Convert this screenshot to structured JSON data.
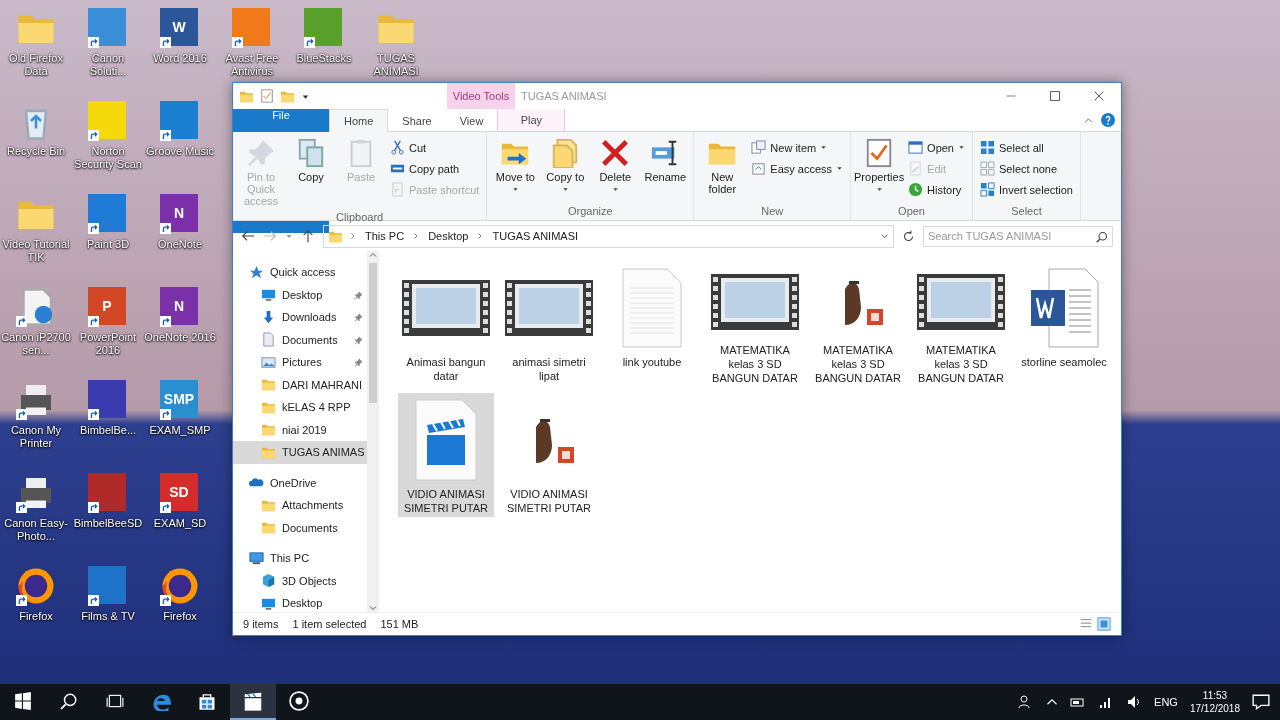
{
  "desktop_columns": [
    [
      {
        "label": "Old Firefox Data",
        "kind": "folder"
      },
      {
        "label": "Recycle Bin",
        "kind": "recycle"
      },
      {
        "label": "Video Tutorial TIK",
        "kind": "folder"
      },
      {
        "label": "Canon iP2700 sen...",
        "kind": "document"
      },
      {
        "label": "Canon My Printer",
        "kind": "printer"
      },
      {
        "label": "Canon Easy-Photo...",
        "kind": "printer"
      },
      {
        "label": "Firefox",
        "kind": "firefox"
      }
    ],
    [
      {
        "label": "Canon Soluti...",
        "kind": "app",
        "color": "#3a8fd8"
      },
      {
        "label": "Norton Security Scan",
        "kind": "app",
        "color": "#f5d90a"
      },
      {
        "label": "Paint 3D",
        "kind": "app",
        "color": "#1f7ad6"
      },
      {
        "label": "PowerPoint 2016",
        "kind": "app",
        "color": "#d24726",
        "icon_text": "P"
      },
      {
        "label": "BimbelBe...",
        "kind": "app",
        "color": "#3b3bb0"
      },
      {
        "label": "BimbelBeeSD",
        "kind": "app",
        "color": "#b02a2a"
      },
      {
        "label": "Films & TV",
        "kind": "app",
        "color": "#1e73c8"
      }
    ],
    [
      {
        "label": "Word 2016",
        "kind": "app",
        "color": "#2b579a",
        "icon_text": "W"
      },
      {
        "label": "Groove Music",
        "kind": "app",
        "color": "#1a7fd0"
      },
      {
        "label": "OneNote",
        "kind": "app",
        "color": "#7b2fa8",
        "icon_text": "N"
      },
      {
        "label": "OneNote 2016",
        "kind": "app",
        "color": "#7b2fa8",
        "icon_text": "N"
      },
      {
        "label": "EXAM_SMP",
        "kind": "app",
        "color": "#2a8fd0",
        "icon_text": "SMP"
      },
      {
        "label": "EXAM_SD",
        "kind": "app",
        "color": "#d62b2b",
        "icon_text": "SD"
      },
      {
        "label": "Firefox",
        "kind": "firefox"
      }
    ],
    [
      {
        "label": "Avast Free Antivirus",
        "kind": "app",
        "color": "#f07a1a"
      }
    ],
    [
      {
        "label": "BlueStacks",
        "kind": "app",
        "color": "#5aa02c"
      }
    ],
    [
      {
        "label": "TUGAS ANIMASI",
        "kind": "folder"
      }
    ]
  ],
  "window": {
    "title": "TUGAS ANIMASI",
    "context_tab_header": "Video Tools",
    "tabs": [
      {
        "label": "File",
        "kind": "file",
        "selected": false
      },
      {
        "label": "Home",
        "kind": "tab",
        "selected": true
      },
      {
        "label": "Share",
        "kind": "tab",
        "selected": false
      },
      {
        "label": "View",
        "kind": "tab",
        "selected": false
      },
      {
        "label": "Play",
        "kind": "context",
        "selected": false
      }
    ],
    "ribbon_groups": [
      {
        "label": "Clipboard",
        "commands": [
          {
            "label": "Pin to Quick access",
            "kind": "large",
            "disabled": true,
            "dropdown": false
          },
          {
            "label": "Copy",
            "kind": "large",
            "disabled": false,
            "dropdown": false
          },
          {
            "label": "Paste",
            "kind": "large",
            "disabled": true,
            "dropdown": false
          },
          {
            "label": "Cut",
            "kind": "small",
            "disabled": false,
            "dropdown": false
          },
          {
            "label": "Copy path",
            "kind": "small",
            "disabled": false,
            "dropdown": false
          },
          {
            "label": "Paste shortcut",
            "kind": "small",
            "disabled": true,
            "dropdown": false
          }
        ]
      },
      {
        "label": "Organize",
        "commands": [
          {
            "label": "Move to",
            "kind": "large",
            "disabled": false,
            "dropdown": true
          },
          {
            "label": "Copy to",
            "kind": "large",
            "disabled": false,
            "dropdown": true
          },
          {
            "label": "Delete",
            "kind": "large",
            "disabled": false,
            "dropdown": true
          },
          {
            "label": "Rename",
            "kind": "large",
            "disabled": false,
            "dropdown": false
          }
        ]
      },
      {
        "label": "New",
        "commands": [
          {
            "label": "New folder",
            "kind": "large",
            "disabled": false,
            "dropdown": false
          },
          {
            "label": "New item",
            "kind": "small",
            "disabled": false,
            "dropdown": true
          },
          {
            "label": "Easy access",
            "kind": "small",
            "disabled": false,
            "dropdown": true
          }
        ]
      },
      {
        "label": "Open",
        "commands": [
          {
            "label": "Properties",
            "kind": "large",
            "disabled": false,
            "dropdown": true
          },
          {
            "label": "Open",
            "kind": "small",
            "disabled": false,
            "dropdown": true
          },
          {
            "label": "Edit",
            "kind": "small",
            "disabled": true,
            "dropdown": false
          },
          {
            "label": "History",
            "kind": "small",
            "disabled": false,
            "dropdown": false
          }
        ]
      },
      {
        "label": "Select",
        "commands": [
          {
            "label": "Select all",
            "kind": "small",
            "disabled": false,
            "dropdown": false
          },
          {
            "label": "Select none",
            "kind": "small",
            "disabled": false,
            "dropdown": false
          },
          {
            "label": "Invert selection",
            "kind": "small",
            "disabled": false,
            "dropdown": false
          }
        ]
      }
    ],
    "breadcrumbs": [
      "This PC",
      "Desktop",
      "TUGAS ANIMASI"
    ],
    "search": {
      "placeholder": "Search TUGAS ANIMASI"
    },
    "nav_tree": [
      {
        "label": "Quick access",
        "kind": "star",
        "selected": false,
        "pinned": false,
        "children": [
          {
            "label": "Desktop",
            "kind": "desktop",
            "selected": false,
            "pinned": true
          },
          {
            "label": "Downloads",
            "kind": "download",
            "selected": false,
            "pinned": true
          },
          {
            "label": "Documents",
            "kind": "documents",
            "selected": false,
            "pinned": true
          },
          {
            "label": "Pictures",
            "kind": "pictures",
            "selected": false,
            "pinned": true
          },
          {
            "label": "DARI MAHRANI",
            "kind": "folder",
            "selected": false,
            "pinned": false
          },
          {
            "label": "kELAS 4 RPP",
            "kind": "folder",
            "selected": false,
            "pinned": false
          },
          {
            "label": "niai 2019",
            "kind": "folder",
            "selected": false,
            "pinned": false
          },
          {
            "label": "TUGAS ANIMAS",
            "kind": "folder",
            "selected": true,
            "pinned": false
          }
        ]
      },
      {
        "label": "OneDrive",
        "kind": "cloud",
        "selected": false,
        "pinned": false,
        "children": [
          {
            "label": "Attachments",
            "kind": "folder",
            "selected": false,
            "pinned": false
          },
          {
            "label": "Documents",
            "kind": "folder",
            "selected": false,
            "pinned": false
          }
        ]
      },
      {
        "label": "This PC",
        "kind": "pc",
        "selected": false,
        "pinned": false,
        "children": [
          {
            "label": "3D Objects",
            "kind": "cube",
            "selected": false,
            "pinned": false
          },
          {
            "label": "Desktop",
            "kind": "desktop",
            "selected": false,
            "pinned": false
          }
        ]
      }
    ],
    "files": [
      {
        "label": "Animasi bangun datar",
        "kind": "video-thumb",
        "selected": false
      },
      {
        "label": "animasi simetri lipat",
        "kind": "video-thumb",
        "selected": false
      },
      {
        "label": "link youtube",
        "kind": "text",
        "selected": false
      },
      {
        "label": "MATEMATIKA kelas 3 SD BANGUN DATAR",
        "kind": "video-thumb",
        "selected": false
      },
      {
        "label": "MATEMATIKA kelas 3 SD BANGUN DATAR",
        "kind": "ppt",
        "selected": false
      },
      {
        "label": "MATEMATIKA kelas 3 SD BANGUN DATAR",
        "kind": "video-thumb",
        "selected": false
      },
      {
        "label": "storline seamolec",
        "kind": "word",
        "selected": false
      },
      {
        "label": "VIDIO ANIMASI SIMETRI PUTAR",
        "kind": "video",
        "selected": true
      },
      {
        "label": "VIDIO ANIMASI SIMETRI PUTAR",
        "kind": "ppt",
        "selected": false
      }
    ],
    "status_bar": {
      "item_count": "9 items",
      "selection": "1 item selected",
      "size": "151 MB"
    }
  },
  "taskbar": {
    "apps": [
      {
        "kind": "start",
        "active": false
      },
      {
        "kind": "search",
        "active": false
      },
      {
        "kind": "taskview",
        "active": false
      },
      {
        "kind": "edge",
        "active": false
      },
      {
        "kind": "store",
        "active": false
      },
      {
        "kind": "films",
        "active": true
      },
      {
        "kind": "circle",
        "active": false
      }
    ],
    "language": "ENG",
    "time": "11:53",
    "date": "17/12/2018"
  }
}
